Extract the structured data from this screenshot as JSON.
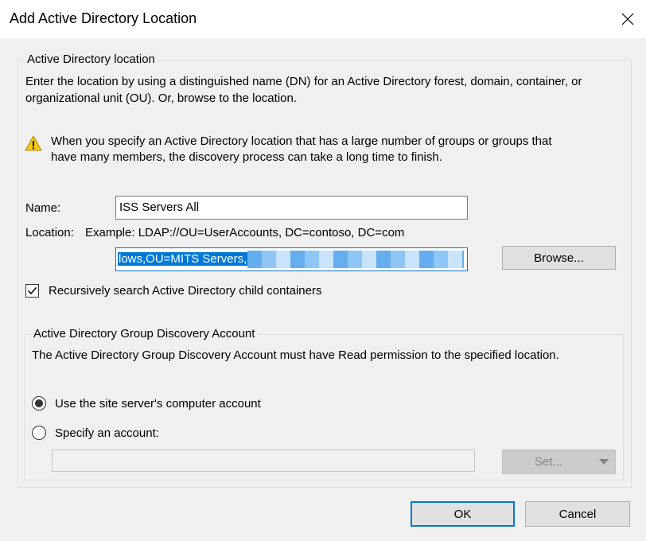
{
  "window": {
    "title": "Add Active Directory Location"
  },
  "ad_location": {
    "group_title": "Active Directory location",
    "desc_line1": "Enter the location by using a distinguished name (DN) for an Active Directory forest, domain, container, or",
    "desc_line2": "organizational unit (OU). Or, browse to the location.",
    "warning_line1": "When you specify an Active Directory location that has a large number of groups or groups that",
    "warning_line2": "have many members, the discovery process can take a long time to finish.",
    "name_label": "Name:",
    "name_value": "ISS Servers All",
    "location_label": "Location:",
    "location_example": "Example: LDAP://OU=UserAccounts, DC=contoso, DC=com",
    "location_value": "lows,OU=MITS Servers,",
    "browse_label": "Browse...",
    "recursive_label": "Recursively search Active Directory child containers",
    "recursive_checked": true
  },
  "discovery_account": {
    "group_title": "Active Directory Group Discovery Account",
    "desc": "The Active Directory Group Discovery Account must have Read permission to the specified location.",
    "option_computer": "Use the site server's computer account",
    "option_specify": "Specify an account:",
    "selected_option": "computer",
    "account_value": "",
    "set_label": "Set..."
  },
  "footer": {
    "ok_label": "OK",
    "cancel_label": "Cancel"
  },
  "colors": {
    "accent": "#0078d7",
    "warning": "#f5c518"
  }
}
